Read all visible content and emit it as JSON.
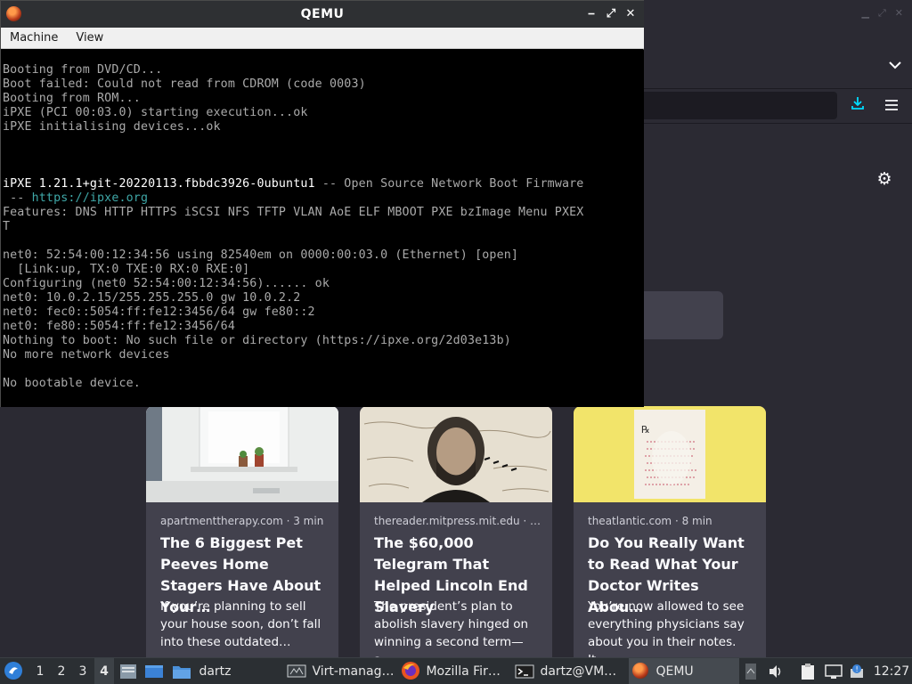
{
  "qemu": {
    "title": "QEMU",
    "controls": {
      "minimize": "⎯",
      "maximize": "⤢",
      "close": "✕"
    },
    "menu": [
      "Machine",
      "View"
    ],
    "console": {
      "l1": "Booting from DVD/CD...",
      "l2": "Boot failed: Could not read from CDROM (code 0003)",
      "l3": "Booting from ROM...",
      "l4": "iPXE (PCI 00:03.0) starting execution...ok",
      "l5": "iPXE initialising devices...ok",
      "l6_bright": "iPXE 1.21.1+git-20220113.fbbdc3926-0ubuntu1",
      "l6_rest": " -- Open Source Network Boot Firmware",
      "l7_dash": " -- ",
      "l7_link": "https://ipxe.org",
      "l8": "Features: DNS HTTP HTTPS iSCSI NFS TFTP VLAN AoE ELF MBOOT PXE bzImage Menu PXEX",
      "l9": "T",
      "l10": "net0: 52:54:00:12:34:56 using 82540em on 0000:00:03.0 (Ethernet) [open]",
      "l11": "  [Link:up, TX:0 TXE:0 RX:0 RXE:0]",
      "l12": "Configuring (net0 52:54:00:12:34:56)...... ok",
      "l13": "net0: 10.0.2.15/255.255.255.0 gw 10.0.2.2",
      "l14": "net0: fec0::5054:ff:fe12:3456/64 gw fe80::2",
      "l15": "net0: fe80::5054:ff:fe12:3456/64",
      "l16": "Nothing to boot: No such file or directory (https://ipxe.org/2d03e13b)",
      "l17": "No more network devices",
      "l18": "No bootable device."
    }
  },
  "firefox": {
    "cards": [
      {
        "source": "apartmenttherapy.com · 3 min",
        "title": "The 6 Biggest Pet Peeves Home Stagers Have About Your…",
        "excerpt": "If you’re planning to sell your house soon, don’t fall into these outdated…"
      },
      {
        "source": "thereader.mitpress.mit.edu · …",
        "title": "The $60,000 Telegram That Helped Lincoln End Slavery",
        "excerpt": "The president’s plan to abolish slavery hinged on winning a second term—a…"
      },
      {
        "source": "theatlantic.com · 8 min",
        "title": "Do You Really Want to Read What Your Doctor Writes Abou…",
        "excerpt": "You’re now allowed to see everything physicians say about you in their notes. It…"
      }
    ]
  },
  "taskbar": {
    "workspaces": [
      "1",
      "2",
      "3",
      "4"
    ],
    "active_workspace": "4",
    "folder_label": "dartz",
    "tasks": [
      {
        "label": "Virt-manag…",
        "icon": "virt-manager-icon"
      },
      {
        "label": "Mozilla Fir…",
        "icon": "firefox-icon"
      },
      {
        "label": "dartz@VM…",
        "icon": "terminal-icon"
      },
      {
        "label": "QEMU",
        "icon": "qemu-icon"
      }
    ],
    "clock": "12:27"
  }
}
